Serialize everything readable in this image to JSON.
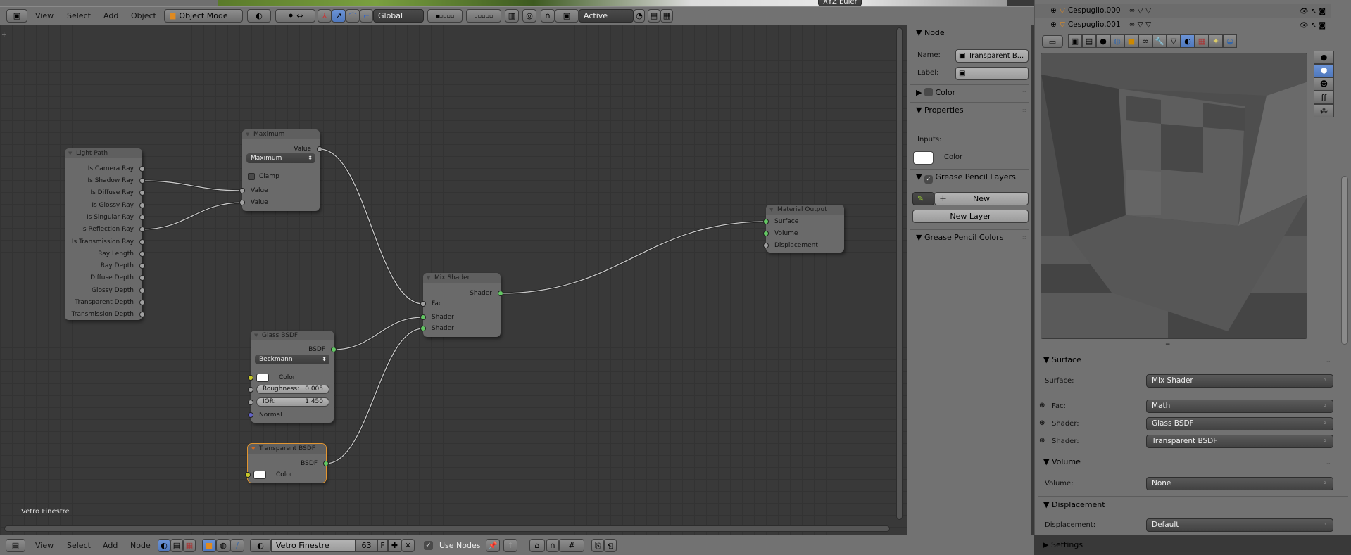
{
  "top_header": {
    "menus": [
      "View",
      "Select",
      "Add",
      "Object"
    ],
    "mode": "Object Mode",
    "orientation": "Global",
    "pivot_target": "Active",
    "rotation_mode": "XYZ Euler"
  },
  "outliner": {
    "rows": [
      {
        "name": "Cespuglio.000"
      },
      {
        "name": "Cespuglio.001"
      }
    ]
  },
  "node_editor": {
    "material_label": "Vetro Finestre",
    "nodes": [
      {
        "id": "light_path",
        "title": "Light Path",
        "rows": [
          {
            "type": "output",
            "label": "Is Camera Ray",
            "socket": "value"
          },
          {
            "type": "output",
            "label": "Is Shadow Ray",
            "socket": "value"
          },
          {
            "type": "output",
            "label": "Is Diffuse Ray",
            "socket": "value"
          },
          {
            "type": "output",
            "label": "Is Glossy Ray",
            "socket": "value"
          },
          {
            "type": "output",
            "label": "Is Singular Ray",
            "socket": "value"
          },
          {
            "type": "output",
            "label": "Is Reflection Ray",
            "socket": "value"
          },
          {
            "type": "output",
            "label": "Is Transmission Ray",
            "socket": "value"
          },
          {
            "type": "output",
            "label": "Ray Length",
            "socket": "value"
          },
          {
            "type": "output",
            "label": "Ray Depth",
            "socket": "value"
          },
          {
            "type": "output",
            "label": "Diffuse Depth",
            "socket": "value"
          },
          {
            "type": "output",
            "label": "Glossy Depth",
            "socket": "value"
          },
          {
            "type": "output",
            "label": "Transparent Depth",
            "socket": "value"
          },
          {
            "type": "output",
            "label": "Transmission Depth",
            "socket": "value"
          }
        ]
      },
      {
        "id": "maximum",
        "title": "Maximum",
        "rows": [
          {
            "type": "output",
            "label": "Value",
            "socket": "value"
          },
          {
            "type": "dropdown",
            "value": "Maximum"
          },
          {
            "type": "checkbox",
            "label": "Clamp",
            "checked": false
          },
          {
            "type": "input",
            "label": "Value",
            "socket": "value"
          },
          {
            "type": "input",
            "label": "Value",
            "socket": "value"
          }
        ]
      },
      {
        "id": "glass",
        "title": "Glass BSDF",
        "rows": [
          {
            "type": "output",
            "label": "BSDF",
            "socket": "shader"
          },
          {
            "type": "dropdown",
            "value": "Beckmann"
          },
          {
            "type": "color",
            "label": "Color",
            "socket": "color",
            "color": "#ffffff"
          },
          {
            "type": "number",
            "label": "Roughness:",
            "value": "0.005",
            "socket": "value"
          },
          {
            "type": "number",
            "label": "IOR:",
            "value": "1.450",
            "socket": "value"
          },
          {
            "type": "input",
            "label": "Normal",
            "socket": "vector"
          }
        ]
      },
      {
        "id": "transparent",
        "title": "Transparent BSDF",
        "active": true,
        "rows": [
          {
            "type": "output",
            "label": "BSDF",
            "socket": "shader"
          },
          {
            "type": "color",
            "label": "Color",
            "socket": "color",
            "color": "#ffffff"
          }
        ]
      },
      {
        "id": "mix",
        "title": "Mix Shader",
        "rows": [
          {
            "type": "output",
            "label": "Shader",
            "socket": "shader"
          },
          {
            "type": "input",
            "label": "Fac",
            "socket": "value"
          },
          {
            "type": "input",
            "label": "Shader",
            "socket": "shader"
          },
          {
            "type": "input",
            "label": "Shader",
            "socket": "shader"
          }
        ]
      },
      {
        "id": "output",
        "title": "Material Output",
        "rows": [
          {
            "type": "input",
            "label": "Surface",
            "socket": "shader"
          },
          {
            "type": "input",
            "label": "Volume",
            "socket": "shader"
          },
          {
            "type": "input",
            "label": "Displacement",
            "socket": "value"
          }
        ]
      }
    ],
    "links": [
      {
        "from": "light_path.1",
        "to": "maximum.3"
      },
      {
        "from": "light_path.5",
        "to": "maximum.4"
      },
      {
        "from": "maximum.0",
        "to": "mix.1"
      },
      {
        "from": "glass.0",
        "to": "mix.2"
      },
      {
        "from": "transparent.0",
        "to": "mix.3"
      },
      {
        "from": "mix.0",
        "to": "output.0"
      }
    ]
  },
  "n_panel": {
    "node_title": "Node",
    "name_label": "Name:",
    "name_value": "Transparent B...",
    "label_label": "Label:",
    "label_value": "",
    "color_title": "Color",
    "properties_title": "Properties",
    "inputs_label": "Inputs:",
    "input_color_label": "Color",
    "gp_layers_title": "Grease Pencil Layers",
    "gp_new": "New",
    "gp_new_layer": "New Layer",
    "gp_colors_title": "Grease Pencil Colors"
  },
  "properties": {
    "surface_title": "Surface",
    "rows": [
      {
        "label": "Surface:",
        "value": "Mix Shader"
      },
      {
        "label": "Fac:",
        "value": "Math"
      },
      {
        "label": "Shader:",
        "value": "Glass BSDF"
      },
      {
        "label": "Shader:",
        "value": "Transparent BSDF"
      }
    ],
    "volume_title": "Volume",
    "volume_label": "Volume:",
    "volume_value": "None",
    "displacement_title": "Displacement",
    "displacement_label": "Displacement:",
    "displacement_value": "Default",
    "settings_title": "Settings"
  },
  "bottom_header": {
    "menus": [
      "View",
      "Select",
      "Add",
      "Node"
    ],
    "material_name": "Vetro Finestre",
    "users": "63",
    "fake_user": "F",
    "use_nodes": "Use Nodes",
    "use_nodes_checked": true
  },
  "colors": {
    "socket_value": "#a1a1a1",
    "socket_shader": "#63c763",
    "socket_color": "#c7c729",
    "socket_vector": "#6363c7",
    "active_node": "#e3952f",
    "selected_button": "#5680c2"
  }
}
